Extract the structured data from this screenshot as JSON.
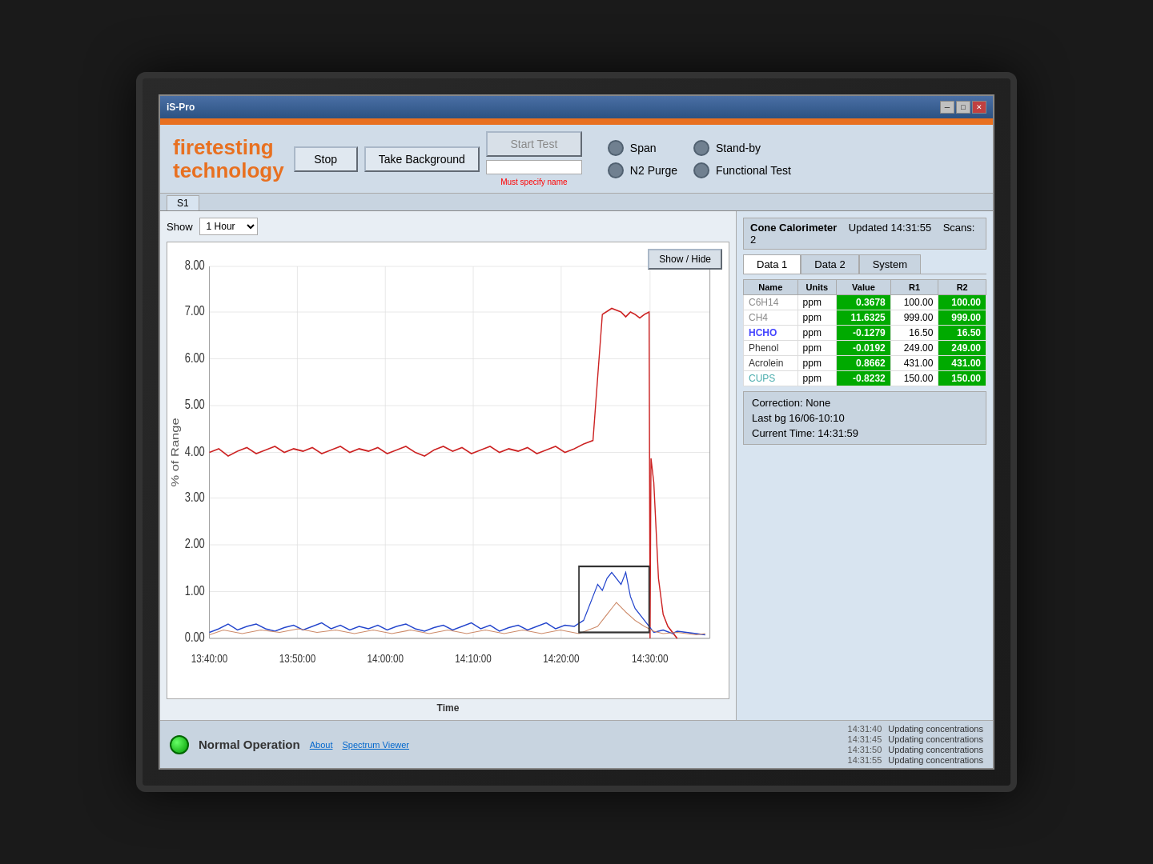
{
  "app": {
    "title": "iS-Pro",
    "orange_stripe": true
  },
  "logo": {
    "line1": "firetesting",
    "line2": "technology"
  },
  "toolbar": {
    "stop_label": "Stop",
    "take_background_label": "Take Background",
    "start_test_label": "Start Test",
    "name_placeholder": "",
    "must_specify": "Must specify name"
  },
  "radio_options": {
    "left": [
      {
        "label": "Span",
        "active": false
      },
      {
        "label": "N2 Purge",
        "active": false
      }
    ],
    "right": [
      {
        "label": "Stand-by",
        "active": false
      },
      {
        "label": "Functional Test",
        "active": false
      }
    ]
  },
  "chart": {
    "show_label": "Show",
    "hour_value": "1 Hour",
    "show_hide_label": "Show / Hide",
    "x_axis_label": "Time",
    "x_ticks": [
      "13:40:00",
      "13:50:00",
      "14:00:00",
      "14:10:00",
      "14:20:00",
      "14:30:00"
    ],
    "y_ticks": [
      "0.00",
      "1.00",
      "2.00",
      "3.00",
      "4.00",
      "5.00",
      "6.00",
      "7.00",
      "8.00"
    ],
    "y_axis_label": "% of Range"
  },
  "cone": {
    "title": "Cone Calorimeter",
    "updated": "Updated 14:31:55",
    "scans": "Scans: 2",
    "tabs": [
      "Data 1",
      "Data 2",
      "System"
    ],
    "active_tab": "Data 1",
    "table": {
      "headers": [
        "Name",
        "Units",
        "Value",
        "R1",
        "R2"
      ],
      "rows": [
        {
          "name": "C6H14",
          "name_class": "name-c6h14",
          "units": "ppm",
          "value": "0.3678",
          "r1": "100.00",
          "r2": "100.00"
        },
        {
          "name": "CH4",
          "name_class": "name-ch4",
          "units": "ppm",
          "value": "11.6325",
          "r1": "999.00",
          "r2": "999.00"
        },
        {
          "name": "HCHO",
          "name_class": "name-hcho",
          "units": "ppm",
          "value": "-0.1279",
          "r1": "16.50",
          "r2": "16.50"
        },
        {
          "name": "Phenol",
          "name_class": "name-phenol",
          "units": "ppm",
          "value": "-0.0192",
          "r1": "249.00",
          "r2": "249.00"
        },
        {
          "name": "Acrolein",
          "name_class": "name-acrolein",
          "units": "ppm",
          "value": "0.8662",
          "r1": "431.00",
          "r2": "431.00"
        },
        {
          "name": "CUPS",
          "name_class": "name-cups",
          "units": "ppm",
          "value": "-0.8232",
          "r1": "150.00",
          "r2": "150.00"
        }
      ]
    }
  },
  "info": {
    "correction": "Correction: None",
    "last_bg": "Last bg 16/06-10:10",
    "current_time": "Current Time: 14:31:59"
  },
  "status": {
    "dot_color": "#00cc00",
    "text": "Normal Operation",
    "log_entries": [
      {
        "time": "14:31:40",
        "message": "Updating concentrations"
      },
      {
        "time": "14:31:45",
        "message": "Updating concentrations"
      },
      {
        "time": "14:31:50",
        "message": "Updating concentrations"
      },
      {
        "time": "14:31:55",
        "message": "Updating concentrations"
      }
    ]
  },
  "footer": {
    "about_label": "About",
    "spectrum_viewer_label": "Spectrum Viewer"
  },
  "tab_strip": {
    "active_tab": "S1"
  }
}
